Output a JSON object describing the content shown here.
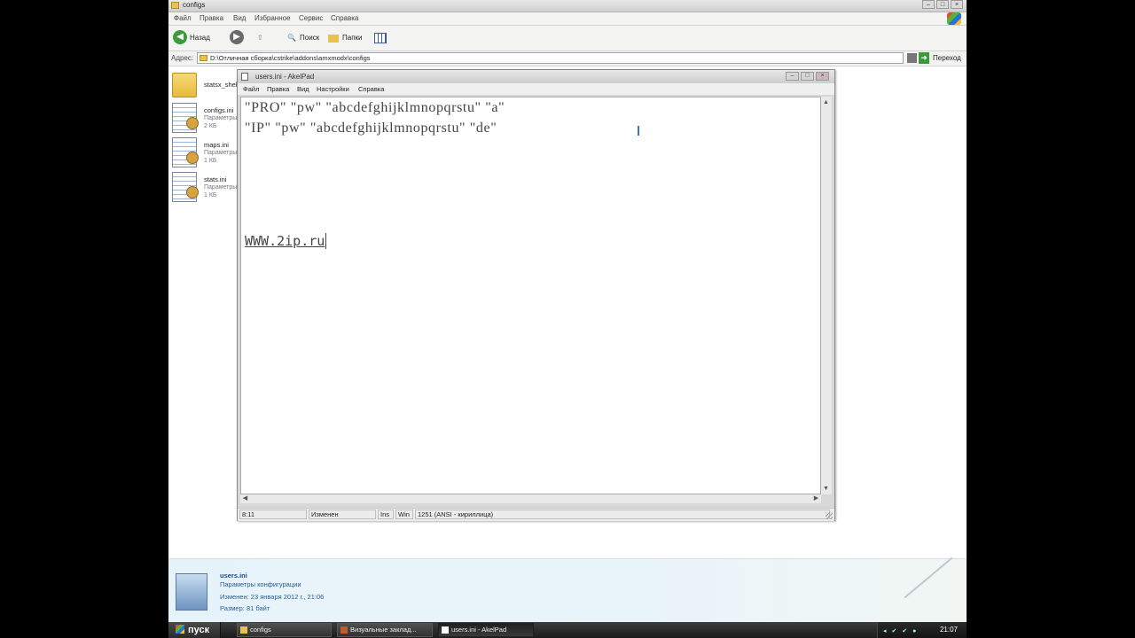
{
  "explorer": {
    "title": "configs",
    "menu": [
      "Файл",
      "Правка",
      "Вид",
      "Избранное",
      "Сервис",
      "Справка"
    ],
    "toolbar": {
      "back": "Назад",
      "search": "Поиск",
      "folders": "Папки"
    },
    "address": {
      "label": "Адрес:",
      "path": "D:\\Отличная сборка\\cstrike\\addons\\amxmodx\\configs",
      "go": "Переход"
    },
    "files": [
      {
        "name": "statsx_shell",
        "type": "",
        "size": "",
        "icon": "folder-icon"
      },
      {
        "name": "configs.ini",
        "type": "Параметры",
        "size": "2 КБ",
        "icon": "ini-file-icon"
      },
      {
        "name": "maps.ini",
        "type": "Параметры",
        "size": "1 КБ",
        "icon": "ini-file-icon"
      },
      {
        "name": "stats.ini",
        "type": "Параметры",
        "size": "1 КБ",
        "icon": "ini-file-icon"
      }
    ],
    "details": {
      "name": "users.ini",
      "type": "Параметры конфигурации",
      "modified": "Изменен: 23 января 2012 г., 21:06",
      "size": "Размер: 81 байт"
    }
  },
  "akelpad": {
    "title": "users.ini - AkelPad",
    "menu": [
      "Файл",
      "Правка",
      "Вид",
      "Настройки",
      "Справка"
    ],
    "lines": [
      "\"PRO\" \"pw\" \"abcdefghijklmnopqrstu\" \"a\"",
      "\"IP\" \"pw\" \"abcdefghijklmnopqrstu\" \"de\""
    ],
    "link": "WWW.2ip.ru",
    "status": {
      "position": "8:11",
      "modified": "Изменен",
      "mode": "Ins",
      "eol": "Win",
      "codepage": "1251  (ANSI - кириллица)"
    }
  },
  "taskbar": {
    "start": "пуск",
    "tasks": [
      "configs",
      "Визуальные заклад...",
      "users.ini - AkelPad"
    ],
    "clock": "21:07"
  }
}
